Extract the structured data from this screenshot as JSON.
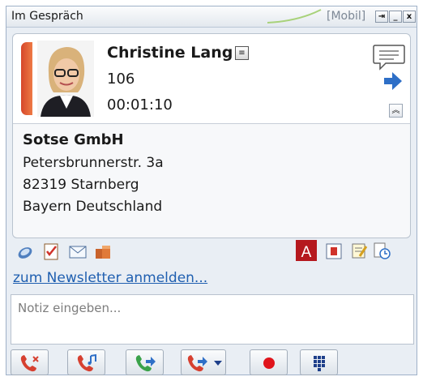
{
  "window": {
    "title": "Im Gespräch",
    "mode_label": "[Mobil]",
    "controls": [
      "pin-icon",
      "minimize-icon",
      "close-icon"
    ]
  },
  "caller": {
    "name": "Christine Lang",
    "extension": "106",
    "duration": "00:01:10"
  },
  "company": {
    "name": "Sotse GmbH",
    "street": "Petersbrunnerstr. 3a",
    "city": "82319 Starnberg",
    "region": "Bayern Deutschland"
  },
  "actions": {
    "left_icons": [
      "phonebook-icon",
      "task-icon",
      "email-icon",
      "boxes-icon"
    ],
    "right_icons": [
      "font-a-icon",
      "contact-card-icon",
      "notes-icon",
      "history-icon"
    ],
    "newsletter_link": "zum Newsletter anmelden..."
  },
  "note": {
    "placeholder": "Notiz eingeben..."
  },
  "toolbar": {
    "buttons": [
      "hangup-icon",
      "music-hold-icon",
      "transfer-icon",
      "forward-icon",
      "record-icon",
      "dialpad-icon"
    ]
  },
  "colors": {
    "accent_red": "#d6472a",
    "link_blue": "#1f5fb0",
    "phone_green": "#3aa24a",
    "record_red": "#e0141b"
  }
}
